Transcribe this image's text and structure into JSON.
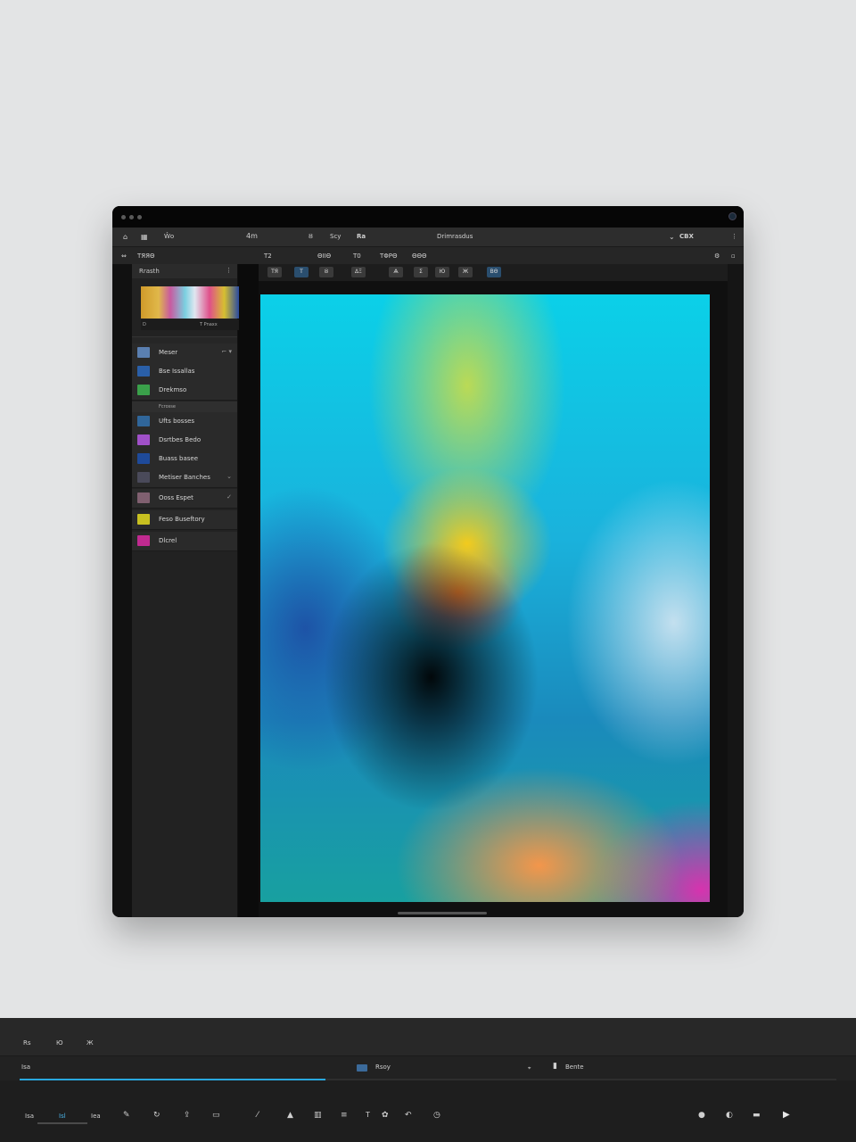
{
  "window": {
    "title": ""
  },
  "menubar": {
    "items": [
      "4m",
      "Ȣ",
      "Ѕcy",
      "Ra"
    ],
    "document_title": "Drimrasdus",
    "right_label": "CBX"
  },
  "optbar": {
    "items": [
      "ТЯЯΘ",
      "T2",
      "ΘΙΙΘ",
      "T0",
      "TΦΡΘ",
      "ΘΘΘ"
    ]
  },
  "toolrow": {
    "items": [
      "ТЯ",
      "Т",
      "Ȣ",
      "ΔΞ",
      "Ѧ",
      "Σ",
      "Ю",
      "Ж",
      "ΒΘ"
    ]
  },
  "panel": {
    "title": "Rrasth",
    "thumb_caption_left": "D",
    "thumb_caption_right": "T Pnaxx",
    "group_label": "Fcrosse",
    "layers": [
      {
        "name": "Meser",
        "color": "#5a7fb0"
      },
      {
        "name": "Bse Issallas",
        "color": "#2a5fa8"
      },
      {
        "name": "Drekmso",
        "color": "#3aa04a"
      },
      {
        "name": "Ufts bosses",
        "color": "#30669a"
      },
      {
        "name": "Dsrtbes Bedo",
        "color": "#a050c8"
      },
      {
        "name": "Buass basee",
        "color": "#1e4a9a"
      },
      {
        "name": "Metiser Banches",
        "color": "#4a4a5a"
      },
      {
        "name": "Ooss Espet",
        "color": "#806070"
      },
      {
        "name": "Feso Buseftory",
        "color": "#c8c020"
      },
      {
        "name": "Dlcrel",
        "color": "#c02a90"
      }
    ]
  },
  "bottom": {
    "row1_items": [
      "Rs",
      "Ю",
      "Ж"
    ],
    "row2_left": "Isa",
    "row2_mid": "Rsoy",
    "row2_right": "Bente",
    "progress": 0.374,
    "row3_items": [
      "Ιsa",
      "Ιsl",
      "Ιea"
    ]
  }
}
